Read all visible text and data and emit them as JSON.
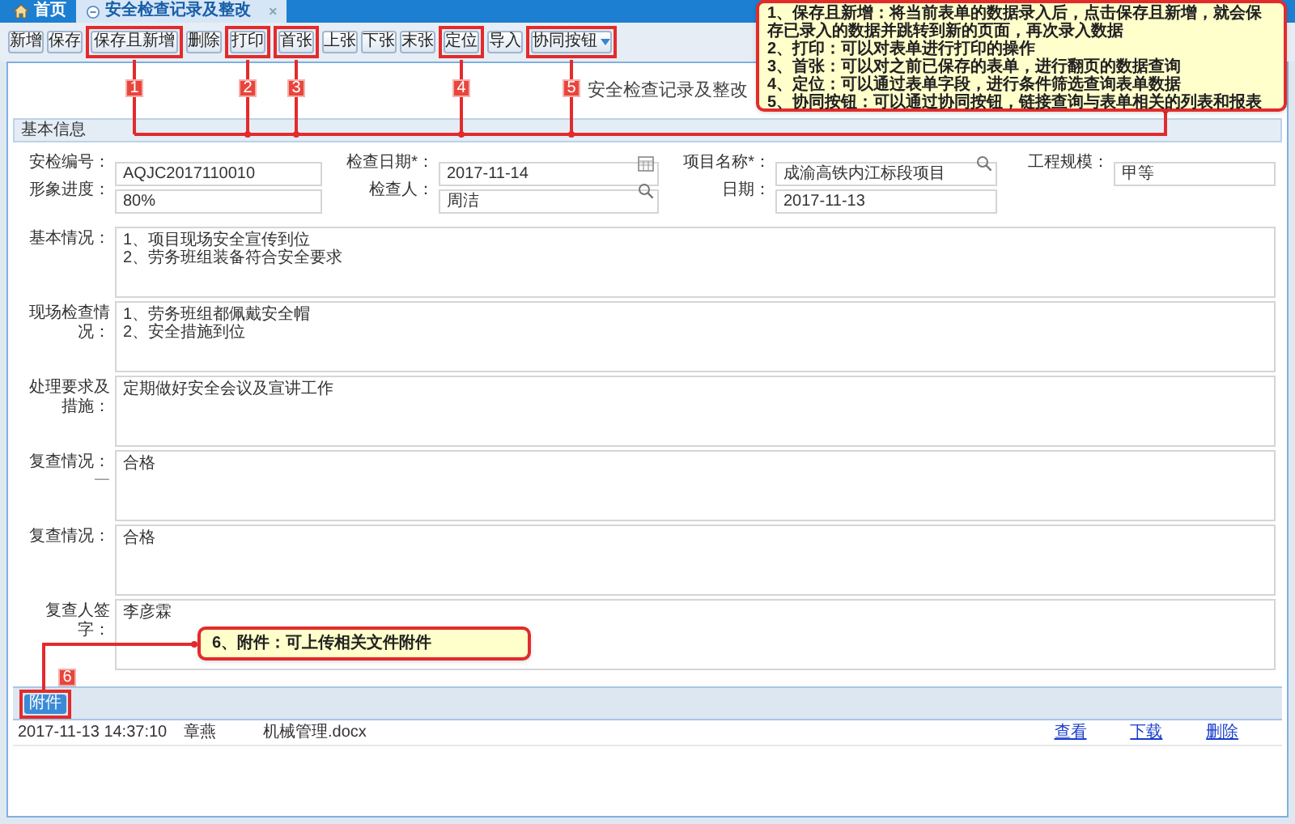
{
  "tabs": [
    {
      "label": "首页",
      "kind": "home",
      "selected": false
    },
    {
      "label": "安全检查记录及整改",
      "kind": "page",
      "selected": true,
      "close": "×"
    }
  ],
  "toolbar": {
    "buttons": [
      {
        "label": "新增"
      },
      {
        "label": "保存"
      },
      {
        "label": "保存且新增",
        "tag": "1"
      },
      {
        "label": "删除"
      },
      {
        "label": "打印",
        "tag": "2"
      },
      {
        "label": "首张",
        "tag": "3"
      },
      {
        "label": "上张"
      },
      {
        "label": "下张"
      },
      {
        "label": "末张"
      },
      {
        "label": "定位",
        "tag": "4"
      },
      {
        "label": "导入"
      },
      {
        "label": "协同按钮",
        "tag": "5",
        "dropdown": true
      }
    ]
  },
  "callouts": [
    {
      "lines": [
        "1、保存且新增：将当前表单的数据录入后，点击保存且新增，就会保存已录入的数据并跳转到新的页面，再次录入数据",
        "2、打印：可以对表单进行打印的操作",
        "3、首张：可以对之前已保存的表单，进行翻页的数据查询",
        "4、定位：可以通过表单字段，进行条件筛选查询表单数据",
        "5、协同按钮：可以通过协同按钮，链接查询与表单相关的列表和报表"
      ]
    },
    {
      "lines": [
        "6、附件：可上传相关文件附件"
      ]
    }
  ],
  "form": {
    "title": "安全检查记录及整改",
    "section": "基本信息",
    "rows": [
      [
        {
          "label": "安检编号：",
          "value": "AQJC2017110010"
        },
        {
          "label": "检查日期*：",
          "value": "2017-11-14",
          "kind": "date"
        },
        {
          "label": "项目名称*：",
          "value": "成渝高铁内江标段项目",
          "kind": "lookup"
        },
        {
          "label": "工程规模：",
          "value": "甲等"
        }
      ],
      [
        {
          "label": "形象进度：",
          "value": "80%"
        },
        {
          "label": "检查人：",
          "value": "周洁",
          "kind": "lookup"
        },
        {
          "label": "日期：",
          "value": "2017-11-13"
        }
      ]
    ],
    "text_areas": [
      {
        "label": "基本情况：",
        "value": "1、项目现场安全宣传到位\n2、劳务班组装备符合安全要求"
      },
      {
        "label": "现场检查情况：",
        "value": "1、劳务班组都佩戴安全帽\n2、安全措施到位"
      },
      {
        "label": "处理要求及措施：",
        "value": "定期做好安全会议及宣讲工作"
      },
      {
        "label": "复查情况：",
        "note": "一",
        "value": "合格"
      },
      {
        "label": "复查情况：",
        "value": "合格"
      },
      {
        "label": "复查人签字：",
        "value": "李彦霖"
      }
    ]
  },
  "attachments": {
    "button": "附件",
    "tag": "6",
    "rows": [
      {
        "time": "2017-11-13 14:37:10",
        "user": "章燕",
        "file": "机械管理.docx",
        "actions": [
          "查看",
          "下载",
          "删除"
        ]
      }
    ]
  }
}
